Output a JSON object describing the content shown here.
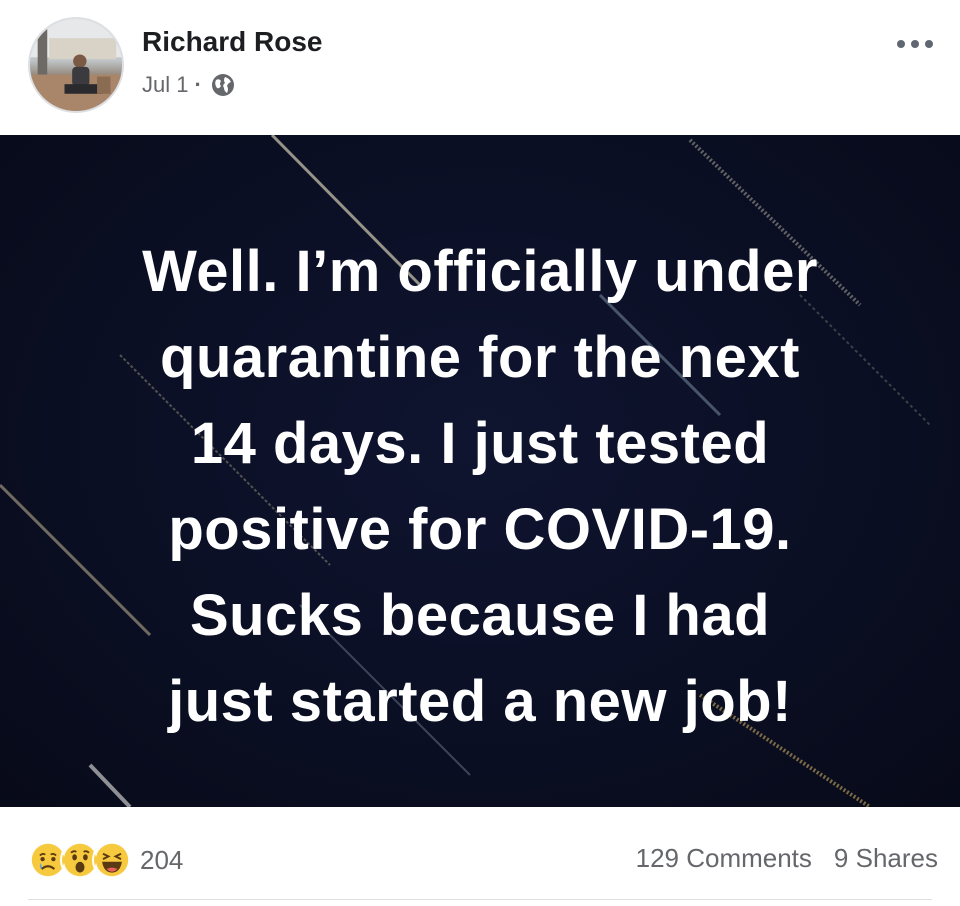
{
  "post": {
    "author": "Richard Rose",
    "date": "Jul 1",
    "separator": "·",
    "privacy_icon": "globe-icon",
    "more_icon": "more-dots-icon",
    "text_lines": [
      "Well. I’m officially under",
      "quarantine for the next",
      "14 days. I just tested",
      "positive for COVID-19.",
      "Sucks because I had",
      "just started a new job!"
    ]
  },
  "engagement": {
    "reaction_icons": [
      "sad-reaction-icon",
      "wow-reaction-icon",
      "haha-reaction-icon"
    ],
    "reaction_count": "204",
    "comments": "129 Comments",
    "shares": "9 Shares"
  },
  "colors": {
    "background_card": "#ffffff",
    "media_background": "#0b0f24",
    "secondary_text": "#65676b",
    "reaction_yellow": "#f7c93e"
  }
}
